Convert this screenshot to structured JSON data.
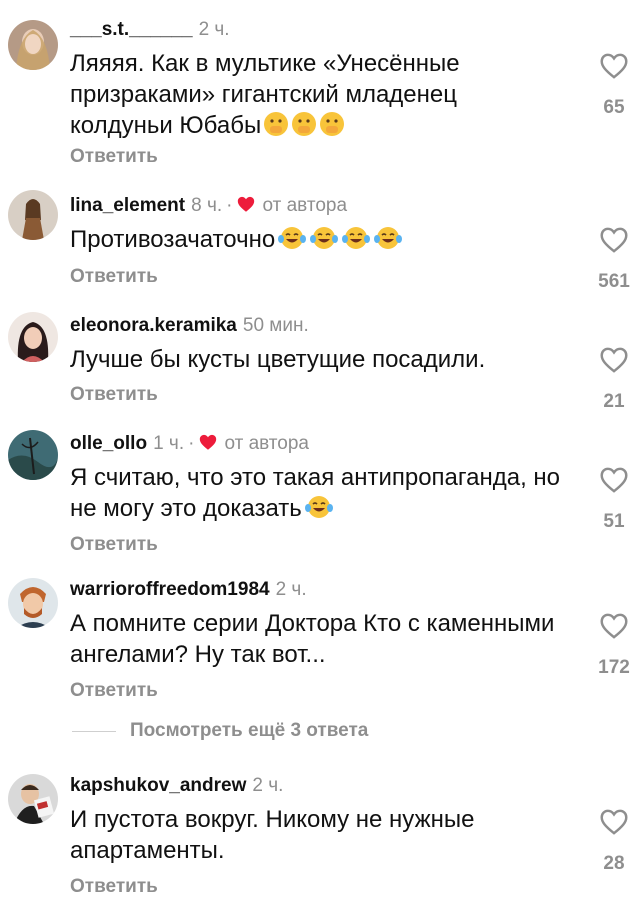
{
  "comments": [
    {
      "username": "___s.t.______",
      "time": "2 ч.",
      "text": "Ляяяя. Как в мультике «Унесённые призраками» гигантский младенец колдуньи Юбабы",
      "emoji": [
        "shushing-face-emoji",
        "shushing-face-emoji",
        "shushing-face-emoji"
      ],
      "reply": "Ответить",
      "likes": "65",
      "liked_by_author": false
    },
    {
      "username": "lina_element",
      "time": "8 ч.",
      "dot": "·",
      "author_label": "от автора",
      "text": "Противозачаточно",
      "emoji": [
        "tears-of-joy-emoji",
        "tears-of-joy-emoji",
        "tears-of-joy-emoji",
        "tears-of-joy-emoji"
      ],
      "reply": "Ответить",
      "likes": "561",
      "liked_by_author": true
    },
    {
      "username": "eleonora.keramika",
      "time": "50 мин.",
      "text": "Лучше бы кусты цветущие посадили.",
      "reply": "Ответить",
      "likes": "21",
      "liked_by_author": false
    },
    {
      "username": "olle_ollo",
      "time": "1 ч.",
      "dot": "·",
      "author_label": "от автора",
      "text": "Я считаю, что это такая антипропаганда, но не могу это доказать",
      "emoji": [
        "tears-of-joy-emoji"
      ],
      "reply": "Ответить",
      "likes": "51",
      "liked_by_author": true
    },
    {
      "username": "warrioroffreedom1984",
      "time": "2 ч.",
      "text": "А помните серии Доктора Кто с каменными ангелами? Ну так вот...",
      "reply": "Ответить",
      "likes": "172",
      "liked_by_author": false
    },
    {
      "username": "kapshukov_andrew",
      "time": "2 ч.",
      "text": "И пустота вокруг. Никому не нужные апартаменты.",
      "reply": "Ответить",
      "likes": "28",
      "liked_by_author": false
    }
  ],
  "view_more": "Посмотреть ещё 3 ответа",
  "colors": {
    "heart_red": "#ed1c3b",
    "muted": "#8e8e8e"
  }
}
